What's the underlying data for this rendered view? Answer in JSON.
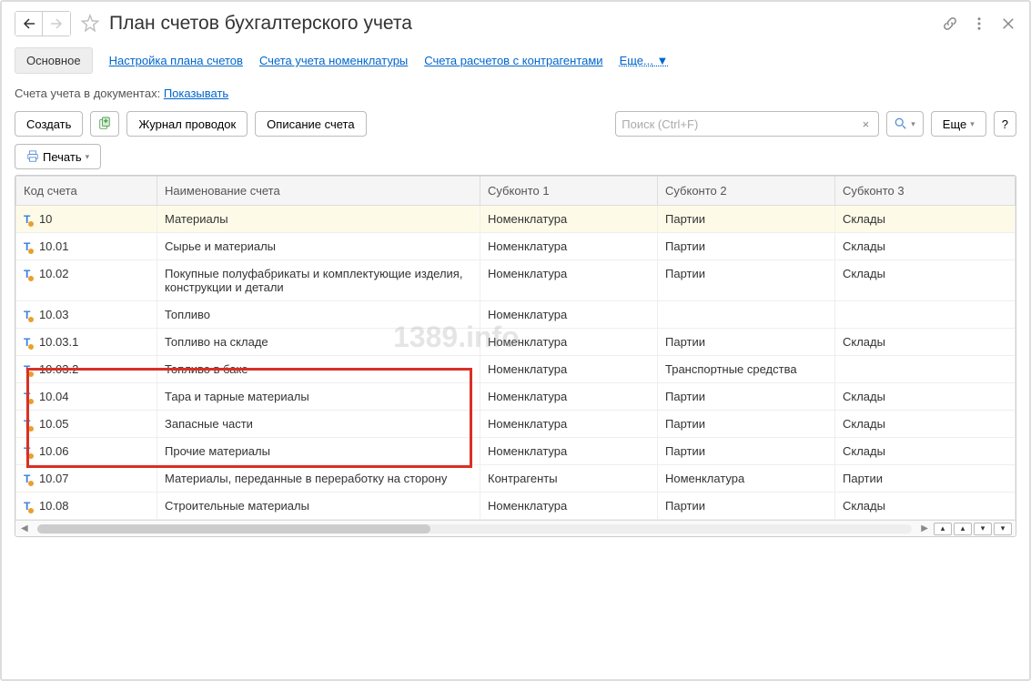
{
  "header": {
    "title": "План счетов бухгалтерского учета"
  },
  "tabs": {
    "main": "Основное",
    "settings": "Настройка плана счетов",
    "nomenclature": "Счета учета номенклатуры",
    "counterparties": "Счета расчетов с контрагентами",
    "more": "Еще..."
  },
  "filter": {
    "label": "Счета учета в документах:",
    "value": "Показывать"
  },
  "toolbar": {
    "create": "Создать",
    "journal": "Журнал проводок",
    "description": "Описание счета",
    "search_placeholder": "Поиск (Ctrl+F)",
    "more": "Еще",
    "help": "?",
    "print": "Печать"
  },
  "columns": {
    "code": "Код счета",
    "name": "Наименование счета",
    "sub1": "Субконто 1",
    "sub2": "Субконто 2",
    "sub3": "Субконто 3"
  },
  "rows": [
    {
      "code": "10",
      "name": "Материалы",
      "sub1": "Номенклатура",
      "sub2": "Партии",
      "sub3": "Склады",
      "hl": true
    },
    {
      "code": "10.01",
      "name": "Сырье и материалы",
      "sub1": "Номенклатура",
      "sub2": "Партии",
      "sub3": "Склады"
    },
    {
      "code": "10.02",
      "name": "Покупные полуфабрикаты и комплектующие изделия, конструкции и детали",
      "sub1": "Номенклатура",
      "sub2": "Партии",
      "sub3": "Склады"
    },
    {
      "code": "10.03",
      "name": "Топливо",
      "sub1": "Номенклатура",
      "sub2": "",
      "sub3": ""
    },
    {
      "code": "10.03.1",
      "name": "Топливо на складе",
      "sub1": "Номенклатура",
      "sub2": "Партии",
      "sub3": "Склады"
    },
    {
      "code": "10.03.2",
      "name": "Топливо в баке",
      "sub1": "Номенклатура",
      "sub2": "Транспортные средства",
      "sub3": ""
    },
    {
      "code": "10.04",
      "name": "Тара и тарные материалы",
      "sub1": "Номенклатура",
      "sub2": "Партии",
      "sub3": "Склады"
    },
    {
      "code": "10.05",
      "name": "Запасные части",
      "sub1": "Номенклатура",
      "sub2": "Партии",
      "sub3": "Склады"
    },
    {
      "code": "10.06",
      "name": "Прочие материалы",
      "sub1": "Номенклатура",
      "sub2": "Партии",
      "sub3": "Склады"
    },
    {
      "code": "10.07",
      "name": "Материалы, переданные в переработку на сторону",
      "sub1": "Контрагенты",
      "sub2": "Номенклатура",
      "sub3": "Партии"
    },
    {
      "code": "10.08",
      "name": "Строительные материалы",
      "sub1": "Номенклатура",
      "sub2": "Партии",
      "sub3": "Склады"
    }
  ],
  "watermark": "1389.info"
}
